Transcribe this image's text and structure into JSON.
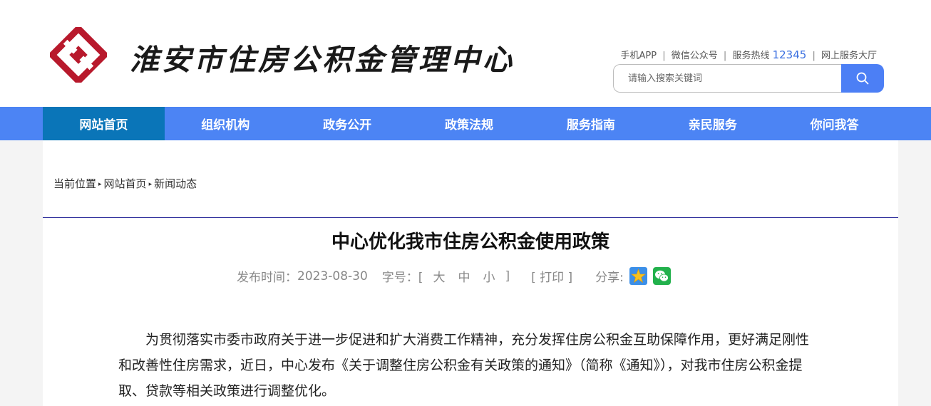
{
  "header": {
    "site_name": "淮安市住房公积金管理中心",
    "brand_color": "#b8192c",
    "logo_icon": "housing-fund-logo-icon",
    "top_links": {
      "app": "手机APP",
      "wechat": "微信公众号",
      "hotline_label": "服务热线",
      "hotline_number": "12345",
      "online_hall": "网上服务大厅",
      "separator": "|"
    },
    "search": {
      "placeholder": "请输入搜索关键词",
      "icon": "search-icon"
    }
  },
  "nav": {
    "items": [
      {
        "label": "网站首页",
        "active": true
      },
      {
        "label": "组织机构",
        "active": false
      },
      {
        "label": "政务公开",
        "active": false
      },
      {
        "label": "政策法规",
        "active": false
      },
      {
        "label": "服务指南",
        "active": false
      },
      {
        "label": "亲民服务",
        "active": false
      },
      {
        "label": "你问我答",
        "active": false
      }
    ],
    "bg_color": "#4c84f4",
    "active_color": "#0a75b8"
  },
  "breadcrumb": {
    "current_label": "当前位置",
    "home": "网站首页",
    "section": "新闻动态"
  },
  "article": {
    "title": "中心优化我市住房公积金使用政策",
    "meta": {
      "date_label": "发布时间：",
      "date": "2023-08-30",
      "font_size_label": "字号：[",
      "font_large": "大",
      "font_medium": "中",
      "font_small": "小",
      "font_close": "]",
      "print": "[ 打印 ]",
      "share_label": "分享:",
      "share_icons": [
        "qzone-star-icon",
        "wechat-icon"
      ]
    },
    "body": "为贯彻落实市委市政府关于进一步促进和扩大消费工作精神，充分发挥住房公积金互助保障作用，更好满足刚性和改善性住房需求，近日，中心发布《关于调整住房公积金有关政策的通知》（简称《通知》），对我市住房公积金提取、贷款等相关政策进行调整优化。"
  }
}
